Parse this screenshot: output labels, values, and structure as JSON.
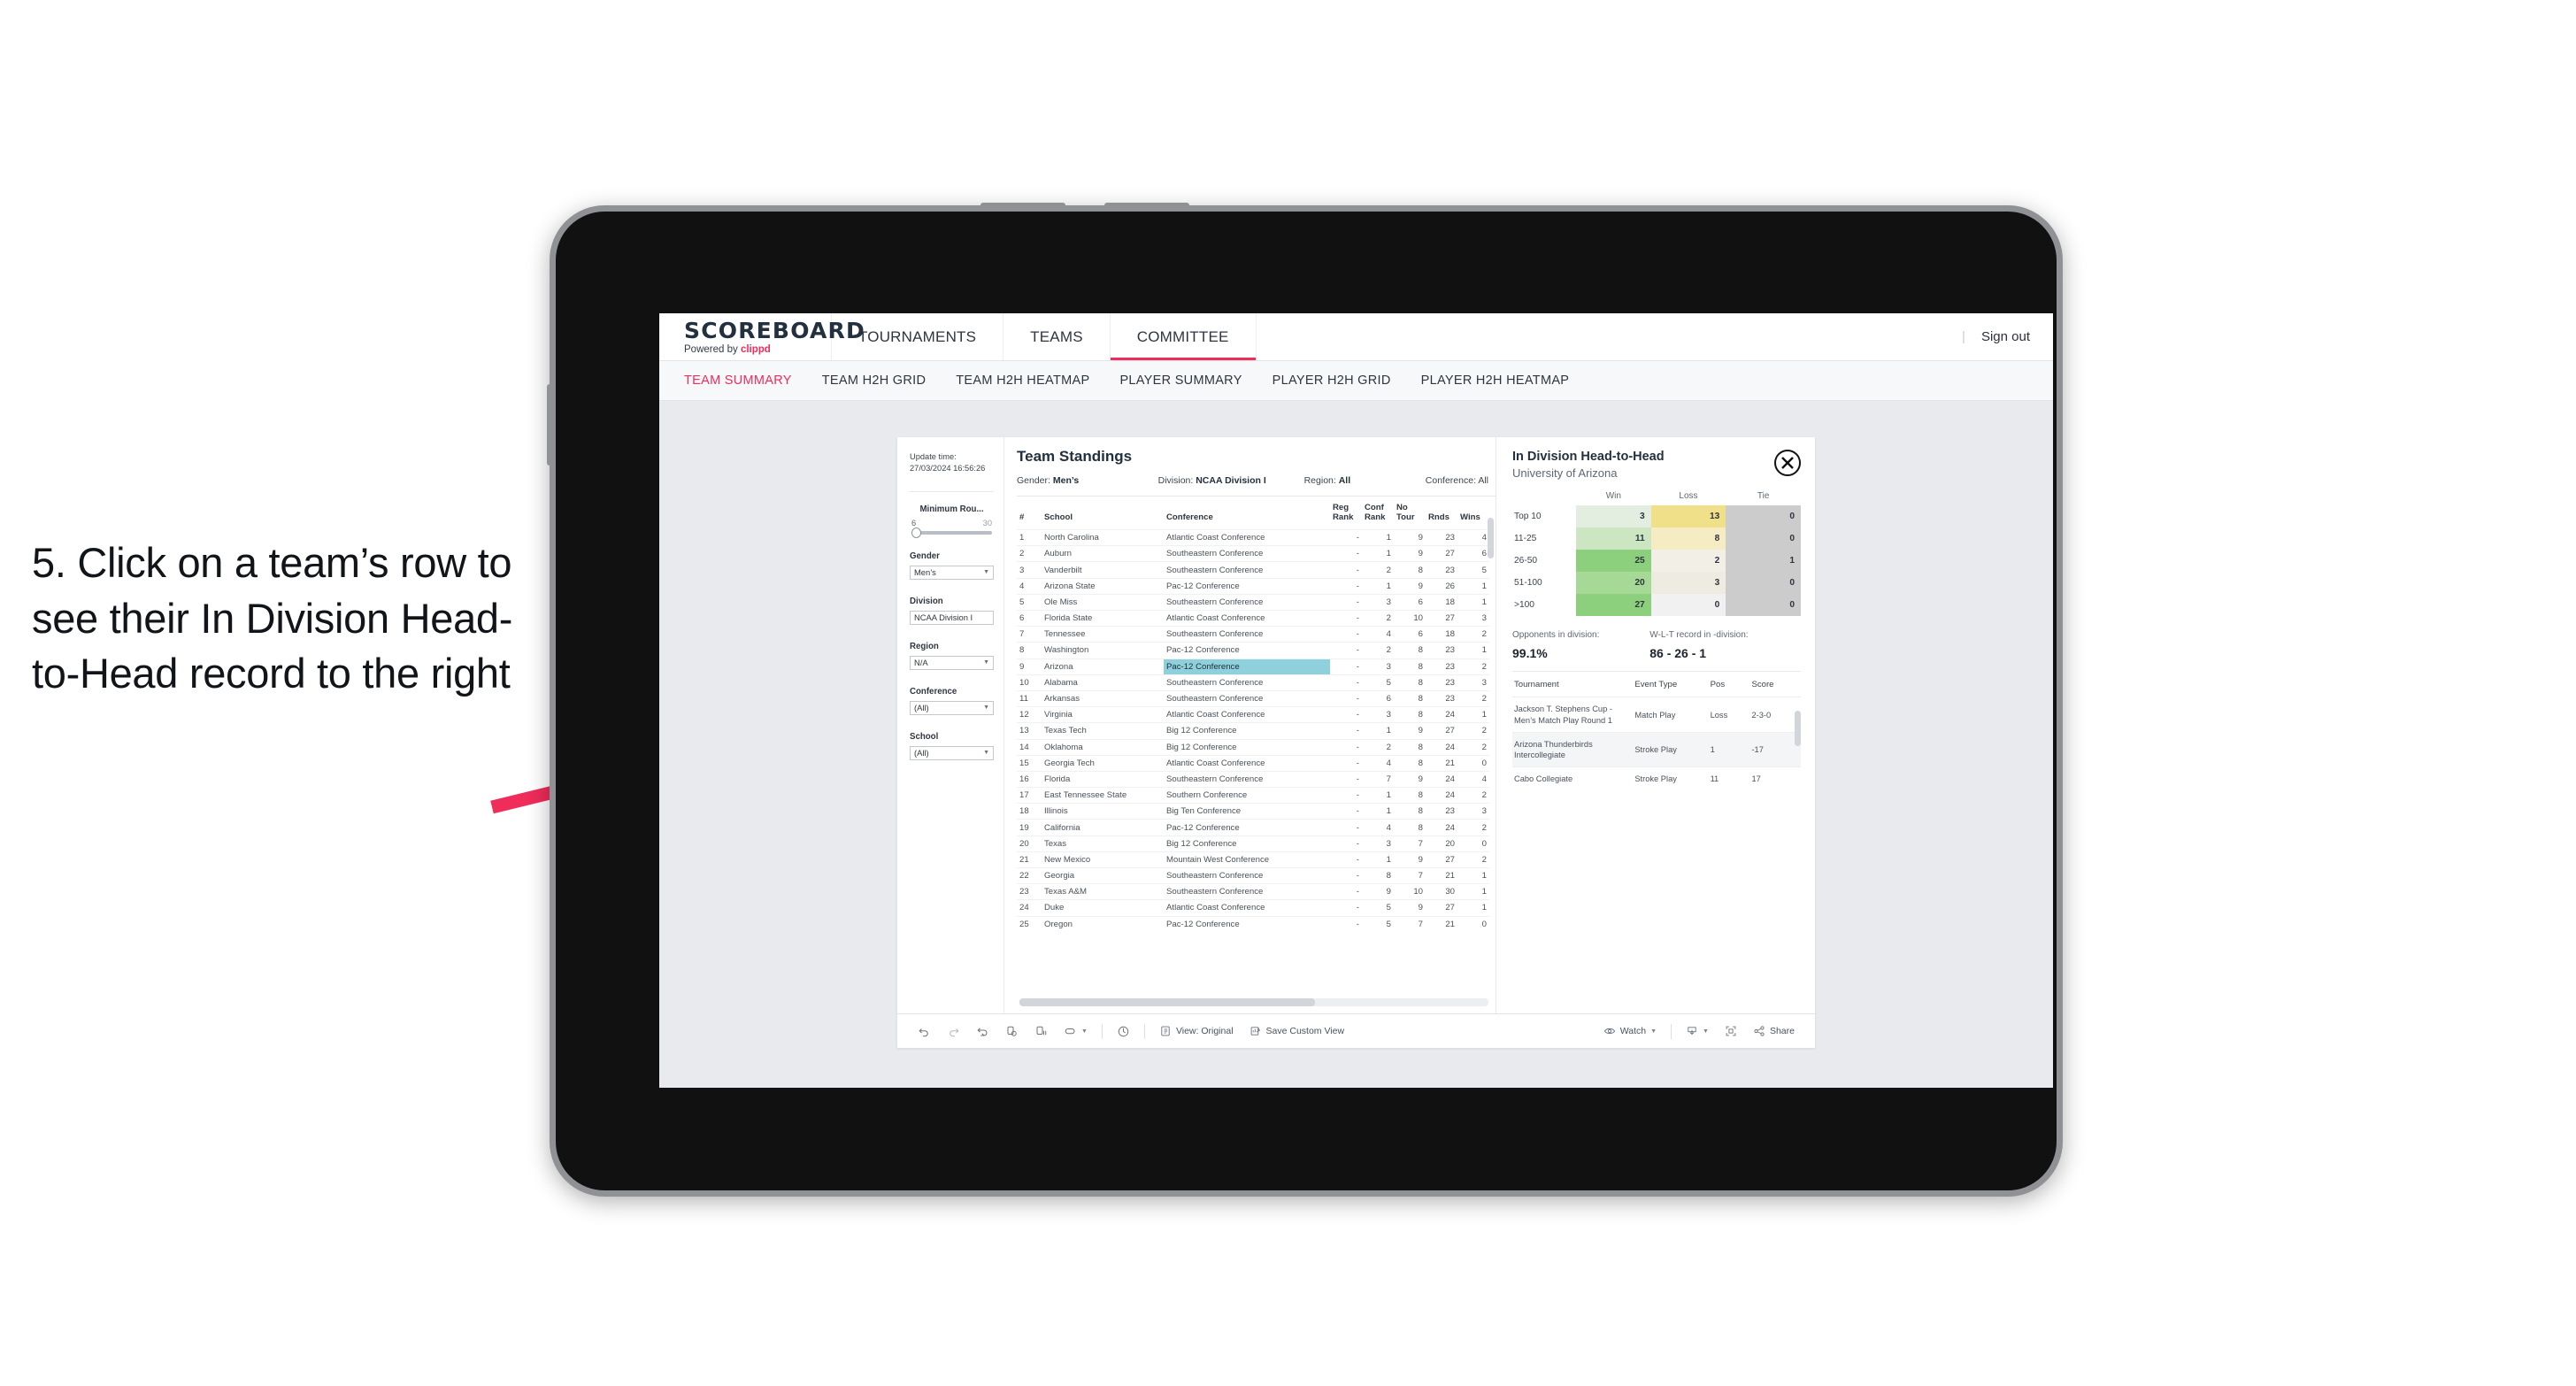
{
  "annotation": {
    "text": "5. Click on a team’s row to see their In Division Head-to-Head record to the right",
    "arrow_color": "#ef2c5a"
  },
  "app": {
    "brand": {
      "title": "SCOREBOARD",
      "powered_prefix": "Powered by ",
      "powered_name": "clippd"
    },
    "top_nav": [
      {
        "label": "TOURNAMENTS",
        "active": false
      },
      {
        "label": "TEAMS",
        "active": false
      },
      {
        "label": "COMMITTEE",
        "active": true
      }
    ],
    "sign_out": "Sign out",
    "sub_nav": [
      {
        "label": "TEAM SUMMARY",
        "active": true
      },
      {
        "label": "TEAM H2H GRID",
        "active": false
      },
      {
        "label": "TEAM H2H HEATMAP",
        "active": false
      },
      {
        "label": "PLAYER SUMMARY",
        "active": false
      },
      {
        "label": "PLAYER H2H GRID",
        "active": false
      },
      {
        "label": "PLAYER H2H HEATMAP",
        "active": false
      }
    ]
  },
  "filters": {
    "update_time_label": "Update time:",
    "update_time_value": "27/03/2024 16:56:26",
    "minimum_rounds": {
      "label": "Minimum Rou...",
      "min": "6",
      "max": "30"
    },
    "gender": {
      "label": "Gender",
      "value": "Men’s"
    },
    "division": {
      "label": "Division",
      "value": "NCAA Division I"
    },
    "region": {
      "label": "Region",
      "value": "N/A"
    },
    "conference": {
      "label": "Conference",
      "value": "(All)"
    },
    "school": {
      "label": "School",
      "value": "(All)"
    }
  },
  "standings": {
    "title": "Team Standings",
    "meta": {
      "gender_key": "Gender: ",
      "gender_val": "Men’s",
      "division_key": "Division: ",
      "division_val": "NCAA Division I",
      "region_key": "Region: ",
      "region_val": "All",
      "conference_key": "Conference: ",
      "conference_val": "All"
    },
    "columns": [
      "#",
      "School",
      "Conference",
      "Reg Rank",
      "Conf Rank",
      "No Tour",
      "Rnds",
      "Wins"
    ],
    "rows": [
      {
        "n": "1",
        "school": "North Carolina",
        "conf": "Atlantic Coast Conference",
        "reg": "-",
        "crank": "1",
        "notour": "9",
        "rnds": "23",
        "wins": "4",
        "selected": false
      },
      {
        "n": "2",
        "school": "Auburn",
        "conf": "Southeastern Conference",
        "reg": "-",
        "crank": "1",
        "notour": "9",
        "rnds": "27",
        "wins": "6",
        "selected": false
      },
      {
        "n": "3",
        "school": "Vanderbilt",
        "conf": "Southeastern Conference",
        "reg": "-",
        "crank": "2",
        "notour": "8",
        "rnds": "23",
        "wins": "5",
        "selected": false
      },
      {
        "n": "4",
        "school": "Arizona State",
        "conf": "Pac-12 Conference",
        "reg": "-",
        "crank": "1",
        "notour": "9",
        "rnds": "26",
        "wins": "1",
        "selected": false
      },
      {
        "n": "5",
        "school": "Ole Miss",
        "conf": "Southeastern Conference",
        "reg": "-",
        "crank": "3",
        "notour": "6",
        "rnds": "18",
        "wins": "1",
        "selected": false
      },
      {
        "n": "6",
        "school": "Florida State",
        "conf": "Atlantic Coast Conference",
        "reg": "-",
        "crank": "2",
        "notour": "10",
        "rnds": "27",
        "wins": "3",
        "selected": false
      },
      {
        "n": "7",
        "school": "Tennessee",
        "conf": "Southeastern Conference",
        "reg": "-",
        "crank": "4",
        "notour": "6",
        "rnds": "18",
        "wins": "2",
        "selected": false
      },
      {
        "n": "8",
        "school": "Washington",
        "conf": "Pac-12 Conference",
        "reg": "-",
        "crank": "2",
        "notour": "8",
        "rnds": "23",
        "wins": "1",
        "selected": false
      },
      {
        "n": "9",
        "school": "Arizona",
        "conf": "Pac-12 Conference",
        "reg": "-",
        "crank": "3",
        "notour": "8",
        "rnds": "23",
        "wins": "2",
        "selected": true
      },
      {
        "n": "10",
        "school": "Alabama",
        "conf": "Southeastern Conference",
        "reg": "-",
        "crank": "5",
        "notour": "8",
        "rnds": "23",
        "wins": "3",
        "selected": false
      },
      {
        "n": "11",
        "school": "Arkansas",
        "conf": "Southeastern Conference",
        "reg": "-",
        "crank": "6",
        "notour": "8",
        "rnds": "23",
        "wins": "2",
        "selected": false
      },
      {
        "n": "12",
        "school": "Virginia",
        "conf": "Atlantic Coast Conference",
        "reg": "-",
        "crank": "3",
        "notour": "8",
        "rnds": "24",
        "wins": "1",
        "selected": false
      },
      {
        "n": "13",
        "school": "Texas Tech",
        "conf": "Big 12 Conference",
        "reg": "-",
        "crank": "1",
        "notour": "9",
        "rnds": "27",
        "wins": "2",
        "selected": false
      },
      {
        "n": "14",
        "school": "Oklahoma",
        "conf": "Big 12 Conference",
        "reg": "-",
        "crank": "2",
        "notour": "8",
        "rnds": "24",
        "wins": "2",
        "selected": false
      },
      {
        "n": "15",
        "school": "Georgia Tech",
        "conf": "Atlantic Coast Conference",
        "reg": "-",
        "crank": "4",
        "notour": "8",
        "rnds": "21",
        "wins": "0",
        "selected": false
      },
      {
        "n": "16",
        "school": "Florida",
        "conf": "Southeastern Conference",
        "reg": "-",
        "crank": "7",
        "notour": "9",
        "rnds": "24",
        "wins": "4",
        "selected": false
      },
      {
        "n": "17",
        "school": "East Tennessee State",
        "conf": "Southern Conference",
        "reg": "-",
        "crank": "1",
        "notour": "8",
        "rnds": "24",
        "wins": "2",
        "selected": false
      },
      {
        "n": "18",
        "school": "Illinois",
        "conf": "Big Ten Conference",
        "reg": "-",
        "crank": "1",
        "notour": "8",
        "rnds": "23",
        "wins": "3",
        "selected": false
      },
      {
        "n": "19",
        "school": "California",
        "conf": "Pac-12 Conference",
        "reg": "-",
        "crank": "4",
        "notour": "8",
        "rnds": "24",
        "wins": "2",
        "selected": false
      },
      {
        "n": "20",
        "school": "Texas",
        "conf": "Big 12 Conference",
        "reg": "-",
        "crank": "3",
        "notour": "7",
        "rnds": "20",
        "wins": "0",
        "selected": false
      },
      {
        "n": "21",
        "school": "New Mexico",
        "conf": "Mountain West Conference",
        "reg": "-",
        "crank": "1",
        "notour": "9",
        "rnds": "27",
        "wins": "2",
        "selected": false
      },
      {
        "n": "22",
        "school": "Georgia",
        "conf": "Southeastern Conference",
        "reg": "-",
        "crank": "8",
        "notour": "7",
        "rnds": "21",
        "wins": "1",
        "selected": false
      },
      {
        "n": "23",
        "school": "Texas A&M",
        "conf": "Southeastern Conference",
        "reg": "-",
        "crank": "9",
        "notour": "10",
        "rnds": "30",
        "wins": "1",
        "selected": false
      },
      {
        "n": "24",
        "school": "Duke",
        "conf": "Atlantic Coast Conference",
        "reg": "-",
        "crank": "5",
        "notour": "9",
        "rnds": "27",
        "wins": "1",
        "selected": false
      },
      {
        "n": "25",
        "school": "Oregon",
        "conf": "Pac-12 Conference",
        "reg": "-",
        "crank": "5",
        "notour": "7",
        "rnds": "21",
        "wins": "0",
        "selected": false
      }
    ],
    "selected_highlight_color": "#8fd0dd"
  },
  "h2h": {
    "title": "In Division Head-to-Head",
    "subtitle": "University of Arizona",
    "close_label": "close",
    "matrix": {
      "columns": [
        "Win",
        "Loss",
        "Tie"
      ],
      "rows": [
        {
          "bucket": "Top 10",
          "win": "3",
          "loss": "13",
          "tie": "0",
          "win_color": "#e3eee1",
          "loss_color": "#f0e08a",
          "tie_color": "#cccccc"
        },
        {
          "bucket": "11-25",
          "win": "11",
          "loss": "8",
          "tie": "0",
          "win_color": "#cde6c2",
          "loss_color": "#f6ecc4",
          "tie_color": "#cccccc"
        },
        {
          "bucket": "26-50",
          "win": "25",
          "loss": "2",
          "tie": "1",
          "win_color": "#8ccf7c",
          "loss_color": "#f1efe6",
          "tie_color": "#cccccc"
        },
        {
          "bucket": "51-100",
          "win": "20",
          "loss": "3",
          "tie": "0",
          "win_color": "#a5d995",
          "loss_color": "#eeebe0",
          "tie_color": "#cccccc"
        },
        {
          "bucket": ">100",
          "win": "27",
          "loss": "0",
          "tie": "0",
          "win_color": "#8ccf7c",
          "loss_color": "#f1f1f1",
          "tie_color": "#cccccc"
        }
      ]
    },
    "stats": {
      "opponents_key": "Opponents in division:",
      "opponents_val": "99.1%",
      "record_key": "W-L-T record in -division:",
      "record_val": "86 - 26 - 1"
    },
    "tournament_columns": [
      "Tournament",
      "Event Type",
      "Pos",
      "Score"
    ],
    "tournaments": [
      {
        "name": "Jackson T. Stephens Cup - Men’s Match Play Round 1",
        "type": "Match Play",
        "pos": "Loss",
        "score": "2-3-0"
      },
      {
        "name": "Arizona Thunderbirds Intercollegiate",
        "type": "Stroke Play",
        "pos": "1",
        "score": "-17"
      },
      {
        "name": "Cabo Collegiate",
        "type": "Stroke Play",
        "pos": "11",
        "score": "17"
      }
    ]
  },
  "toolbar": {
    "undo": "undo-icon",
    "redo": "redo-icon",
    "revert": "revert-icon",
    "refresh": "refresh-data-icon",
    "pause": "pause-auto-update-icon",
    "view_original_label": "View: Original",
    "save_custom_view_label": "Save Custom View",
    "watch_label": "Watch",
    "share_label": "Share"
  }
}
